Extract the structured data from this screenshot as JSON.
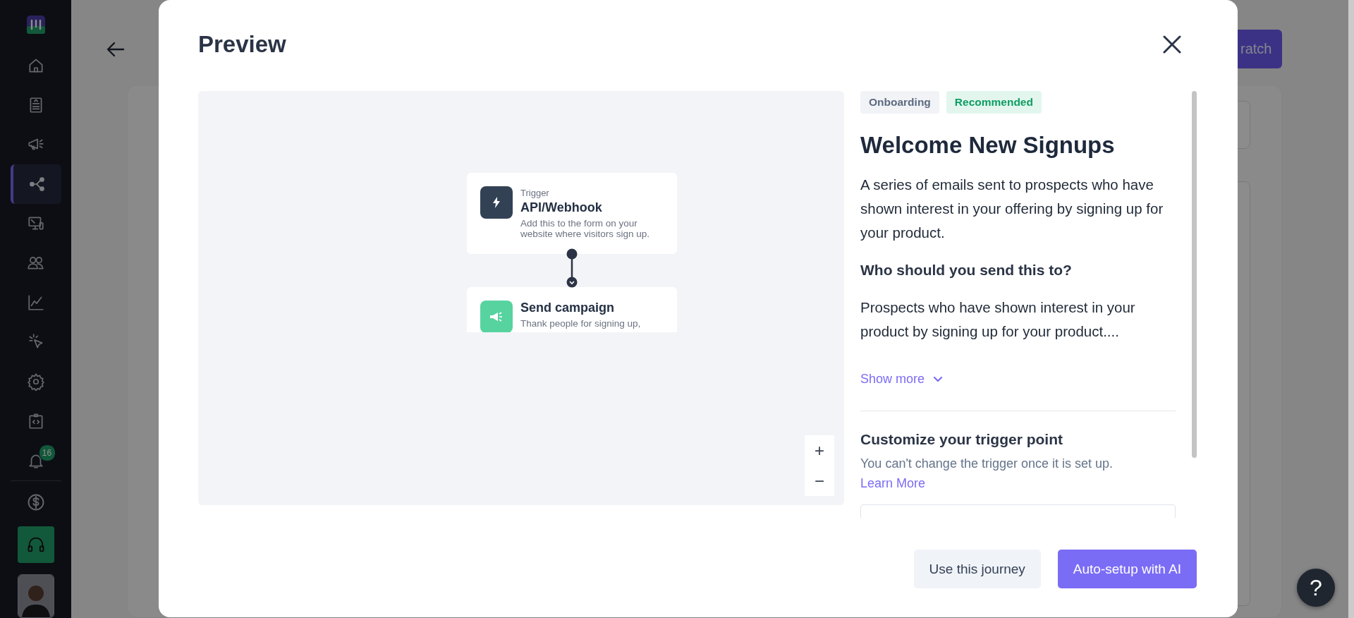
{
  "sidebar": {
    "items": [
      {
        "kind": "home",
        "selected": false
      },
      {
        "kind": "list",
        "selected": false
      },
      {
        "kind": "megaphone",
        "selected": false
      },
      {
        "kind": "share",
        "selected": true
      },
      {
        "kind": "monitor",
        "selected": false
      },
      {
        "kind": "people",
        "selected": false
      },
      {
        "kind": "chart",
        "selected": false
      },
      {
        "kind": "pointer",
        "selected": false
      },
      {
        "kind": "gear",
        "selected": false
      },
      {
        "kind": "code",
        "selected": false
      },
      {
        "kind": "bell",
        "selected": false,
        "badge": "16"
      }
    ],
    "bottom_items": [
      {
        "kind": "dollar"
      },
      {
        "kind": "headset"
      }
    ]
  },
  "page": {
    "header_button": "ratch"
  },
  "modal": {
    "title": "Preview",
    "canvas": {
      "nodes": [
        {
          "kind": "trigger",
          "label": "Trigger",
          "title": "API/Webhook",
          "description": "Add this to the form on your website where visitors sign up."
        },
        {
          "kind": "campaign",
          "title": "Send campaign",
          "description": "Thank people for signing up,"
        }
      ],
      "zoom_controls": [
        "+",
        "−"
      ]
    },
    "details": {
      "tags": [
        {
          "label": "Onboarding",
          "kind": "category"
        },
        {
          "label": "Recommended",
          "kind": "recommended"
        }
      ],
      "title": "Welcome New Signups",
      "description": "A series of emails sent to prospects who have shown interest in your offering by signing up for your product.",
      "audience_heading": "Who should you send this to?",
      "audience": "Prospects who have shown interest in your product by signing up for your product....",
      "show_more": "Show more",
      "trigger_heading": "Customize your trigger point",
      "trigger_note": "You can't change the trigger once it is set up.",
      "learn_more": "Learn More"
    },
    "buttons": [
      {
        "label": "Use this journey",
        "kind": "secondary"
      },
      {
        "label": "Auto-setup with AI",
        "kind": "primary"
      }
    ]
  },
  "help_button": "?"
}
